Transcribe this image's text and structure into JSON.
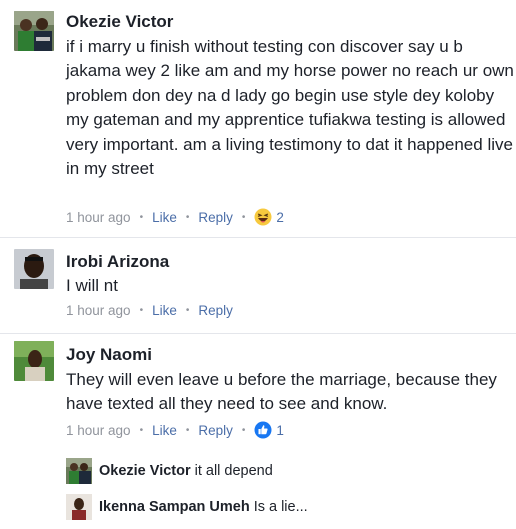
{
  "comments": [
    {
      "author": "Okezie Victor",
      "text": "if i marry u finish without testing con discover say u b jakama wey 2 like am and my horse power no reach ur own problem don dey na d lady go begin use style dey koloby my gateman and my apprentice tufiakwa testing is allowed very important. am a living testimony to dat it happened live in my street",
      "time": "1 hour ago",
      "like": "Like",
      "reply": "Reply",
      "reaction_icon": "haha-emoji-icon",
      "reaction_count": "2"
    },
    {
      "author": "Irobi Arizona",
      "text": "I will nt",
      "time": "1 hour ago",
      "like": "Like",
      "reply": "Reply"
    },
    {
      "author": "Joy Naomi",
      "text": "They will even leave u before the marriage, because they have texted all they need to see and know.",
      "time": "1 hour ago",
      "like": "Like",
      "reply": "Reply",
      "reaction_icon": "like-thumbs-up-icon",
      "reaction_count": "1"
    }
  ],
  "replies": [
    {
      "author": "Okezie Victor",
      "text": "it all depend"
    },
    {
      "author": "Ikenna Sampan Umeh",
      "text": "Is a lie..."
    }
  ],
  "separator": "•",
  "colors": {
    "link": "#4b6ea8",
    "meta": "#90949c",
    "text": "#1d2129",
    "like_blue": "#1877f2",
    "haha_yellow": "#f7c93e"
  }
}
